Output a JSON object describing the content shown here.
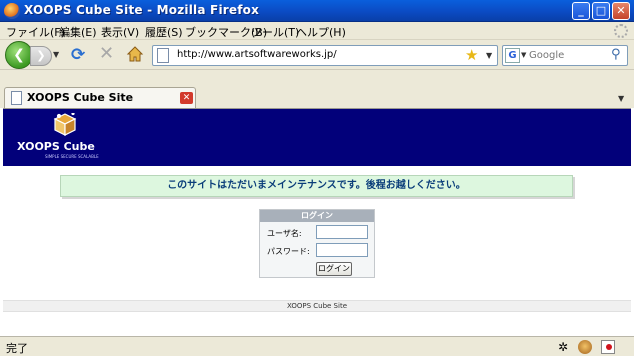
{
  "window": {
    "title": "XOOPS Cube Site - Mozilla Firefox",
    "minimize_icon": "minimize-icon",
    "maximize_icon": "maximize-icon",
    "close_icon": "close-icon"
  },
  "menu": {
    "items": [
      "ファイル(F)",
      "編集(E)",
      "表示(V)",
      "履歴(S)",
      "ブックマーク(B)",
      "ツール(T)",
      "ヘルプ(H)"
    ]
  },
  "toolbar": {
    "url": "http://www.artsoftwareworks.jp/",
    "search_placeholder": "Google"
  },
  "tabs": [
    {
      "label": "XOOPS Cube Site",
      "active": true
    }
  ],
  "page": {
    "brand_color": "#02007a",
    "logo_text": "XOOPS Cube",
    "logo_tagline": "SIMPLE SECURE SCALABLE",
    "notice": "このサイトはただいまメインテナンスです。後程お越しください。",
    "login": {
      "heading": "ログイン",
      "username_label": "ユーザ名:",
      "password_label": "パスワード:",
      "username_value": "",
      "password_value": "",
      "submit_label": "ログイン"
    },
    "footer": "XOOPS Cube Site"
  },
  "status": {
    "text": "完了"
  }
}
